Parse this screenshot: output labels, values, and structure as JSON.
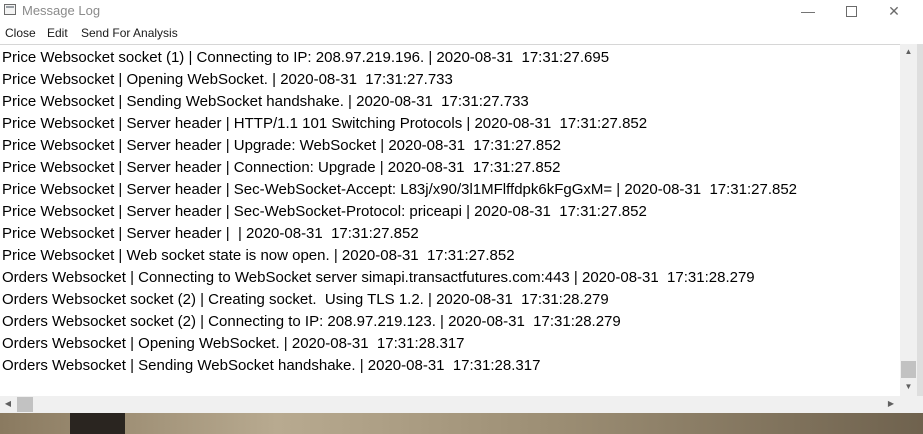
{
  "window": {
    "title": "Message Log",
    "min_symbol": "—",
    "close_symbol": "✕"
  },
  "menu": {
    "items": [
      "Close",
      "Edit",
      "Send For Analysis"
    ]
  },
  "log": {
    "lines": [
      "Price Websocket socket (1) | Connecting to IP: 208.97.219.196. | 2020-08-31  17:31:27.695",
      "Price Websocket | Opening WebSocket. | 2020-08-31  17:31:27.733",
      "Price Websocket | Sending WebSocket handshake. | 2020-08-31  17:31:27.733",
      "Price Websocket | Server header | HTTP/1.1 101 Switching Protocols | 2020-08-31  17:31:27.852",
      "Price Websocket | Server header | Upgrade: WebSocket | 2020-08-31  17:31:27.852",
      "Price Websocket | Server header | Connection: Upgrade | 2020-08-31  17:31:27.852",
      "Price Websocket | Server header | Sec-WebSocket-Accept: L83j/x90/3l1MFlffdpk6kFgGxM= | 2020-08-31  17:31:27.852",
      "Price Websocket | Server header | Sec-WebSocket-Protocol: priceapi | 2020-08-31  17:31:27.852",
      "Price Websocket | Server header |  | 2020-08-31  17:31:27.852",
      "Price Websocket | Web socket state is now open. | 2020-08-31  17:31:27.852",
      "Orders Websocket | Connecting to WebSocket server simapi.transactfutures.com:443 | 2020-08-31  17:31:28.279",
      "Orders Websocket socket (2) | Creating socket.  Using TLS 1.2. | 2020-08-31  17:31:28.279",
      "Orders Websocket socket (2) | Connecting to IP: 208.97.219.123. | 2020-08-31  17:31:28.279",
      "Orders Websocket | Opening WebSocket. | 2020-08-31  17:31:28.317",
      "Orders Websocket | Sending WebSocket handshake. | 2020-08-31  17:31:28.317"
    ]
  },
  "scrollbar": {
    "vertical_position": 0.92,
    "horizontal_position": 0.0
  }
}
